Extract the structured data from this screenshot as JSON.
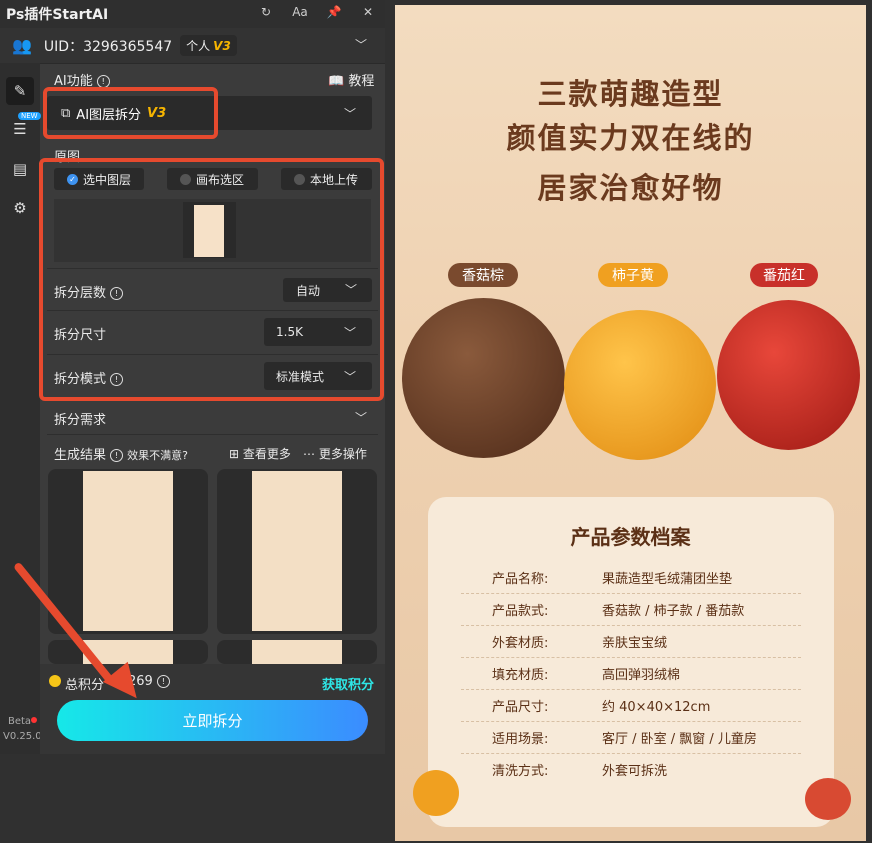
{
  "app": {
    "title": "Ps插件StartAI",
    "icons": [
      "refresh-icon",
      "font-icon",
      "pin-icon",
      "close-icon"
    ],
    "font_icon_label": "Aa"
  },
  "user": {
    "uid_label": "UID：3296365547",
    "account_type": "个人",
    "version_tag": "V3"
  },
  "sidebar": {
    "items": [
      "edit-icon",
      "layers-icon",
      "clipboard-icon",
      "gear-icon"
    ],
    "new_badge": "NEW",
    "beta": "Beta",
    "version": "V0.25.0"
  },
  "ai_function": {
    "label": "AI功能",
    "tutorial": "教程",
    "selected": "AI图层拆分",
    "selected_tag": "V3"
  },
  "source": {
    "label": "原图",
    "options": [
      "选中图层",
      "画布选区",
      "本地上传"
    ],
    "selected_index": 0
  },
  "settings": {
    "layers": {
      "label": "拆分层数",
      "value": "自动"
    },
    "size": {
      "label": "拆分尺寸",
      "value": "1.5K"
    },
    "mode": {
      "label": "拆分模式",
      "value": "标准模式"
    }
  },
  "requirements": {
    "label": "拆分需求"
  },
  "results": {
    "label": "生成结果",
    "unsatisfied": "效果不满意?",
    "view_more": "查看更多",
    "more_actions": "更多操作"
  },
  "points": {
    "label": "总积分",
    "value": "269",
    "get": "获取积分"
  },
  "cta": {
    "label": "立即拆分"
  },
  "product": {
    "title_lines": [
      "三款萌趣造型",
      "颜值实力双在线的",
      "居家治愈好物"
    ],
    "tags": [
      {
        "label": "香菇棕",
        "color": "#7a4a2e"
      },
      {
        "label": "柿子黄",
        "color": "#f0a020"
      },
      {
        "label": "番茄红",
        "color": "#c8302a"
      }
    ],
    "table_title": "产品参数档案",
    "rows": [
      {
        "k": "产品名称:",
        "v": "果蔬造型毛绒蒲团坐垫"
      },
      {
        "k": "产品款式:",
        "v": "香菇款 / 柿子款 / 番茄款"
      },
      {
        "k": "外套材质:",
        "v": "亲肤宝宝绒"
      },
      {
        "k": "填充材质:",
        "v": "高回弹羽绒棉"
      },
      {
        "k": "产品尺寸:",
        "v": "约 40×40×12cm"
      },
      {
        "k": "适用场景:",
        "v": "客厅 / 卧室 / 飘窗 / 儿童房"
      },
      {
        "k": "清洗方式:",
        "v": "外套可拆洗"
      }
    ]
  },
  "colors": {
    "accent": "#e64a2e",
    "blue": "#3b8cff",
    "gold": "#f5b400"
  }
}
